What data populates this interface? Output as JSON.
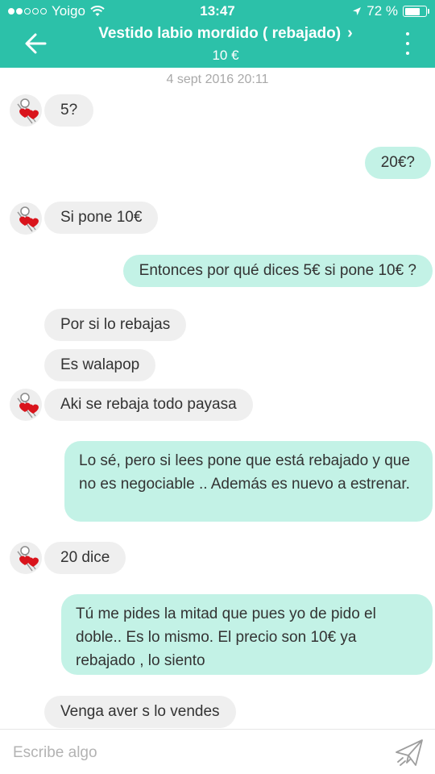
{
  "status_bar": {
    "carrier": "Yoigo",
    "time": "13:47",
    "battery_percent": "72 %",
    "battery_level": 0.72
  },
  "header": {
    "title": "Vestido labio mordido ( rebajado)",
    "price": "10 €",
    "back_icon": "arrow-left-icon",
    "more_icon": "more-vertical-icon"
  },
  "timestamp": "4 sept 2016 20:11",
  "messages": [
    {
      "from": "them",
      "text": "5?"
    },
    {
      "from": "me",
      "text": "20€?"
    },
    {
      "from": "them",
      "text": "Si pone 10€"
    },
    {
      "from": "me",
      "text": "Entonces por qué dices 5€ si pone 10€ ?"
    },
    {
      "from": "them",
      "text": "Por si lo rebajas"
    },
    {
      "from": "them",
      "text": "Es walapop"
    },
    {
      "from": "them",
      "text": "Aki se rebaja todo payasa"
    },
    {
      "from": "me",
      "text": "Lo sé, pero si lees pone que está rebajado y que no es negociable .. Además es nuevo a estrenar."
    },
    {
      "from": "them",
      "text": "20 dice"
    },
    {
      "from": "me",
      "text": "Tú me pides la mitad que pues yo de pido el doble.. Es lo mismo. El precio son 10€ ya rebajado , lo siento"
    },
    {
      "from": "them",
      "text": "Venga aver s lo vendes"
    }
  ],
  "composer": {
    "placeholder": "Escribe algo",
    "send_icon": "paper-plane-icon"
  },
  "colors": {
    "header_bg": "#2cc1a9",
    "incoming_bubble": "#efefef",
    "outgoing_bubble": "#c3f2e6"
  }
}
